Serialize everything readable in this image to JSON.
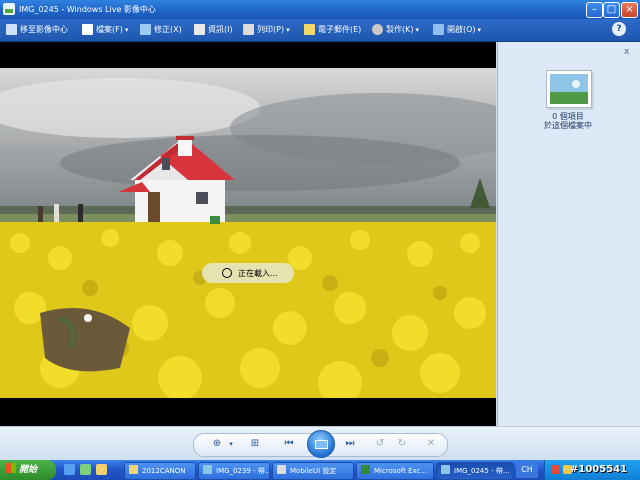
{
  "window": {
    "title": "IMG_0245 - Windows Live 影像中心"
  },
  "toolbar": {
    "items": [
      {
        "label": "移至影像中心",
        "has_menu": false
      },
      {
        "label": "檔案(F)",
        "has_menu": true
      },
      {
        "label": "修正(X)",
        "has_menu": false
      },
      {
        "label": "資訊(I)",
        "has_menu": false
      },
      {
        "label": "列印(P)",
        "has_menu": true
      },
      {
        "label": "電子郵件(E)",
        "has_menu": false
      },
      {
        "label": "製作(K)",
        "has_menu": true
      },
      {
        "label": "開啟(O)",
        "has_menu": true
      }
    ],
    "help_label": "?"
  },
  "viewer": {
    "loading_text": "正在載入..."
  },
  "info_pane": {
    "close_label": "x",
    "line1": "0 個項目",
    "line2": "於這個檔案中"
  },
  "controls": {
    "zoom_icon": "magnifier-icon",
    "fit_icon": "actual-size-icon",
    "prev_icon": "previous-icon",
    "slideshow_icon": "slideshow-icon",
    "next_icon": "next-icon",
    "rotate_ccw_icon": "rotate-counterclockwise-icon",
    "rotate_cw_icon": "rotate-clockwise-icon",
    "delete_icon": "delete-icon"
  },
  "taskbar": {
    "start_label": "開始",
    "tasks": [
      {
        "label": "2012CANON",
        "active": false
      },
      {
        "label": "IMG_0239 - 帶...",
        "active": false
      },
      {
        "label": "MobileUI 設定",
        "active": false
      },
      {
        "label": "Microsoft Exc...",
        "active": false
      },
      {
        "label": "IMG_0245 - 帶...",
        "active": true
      }
    ],
    "language": "CH",
    "watermark": "#1005541"
  },
  "colors": {
    "toolbar": "#2d6bc9",
    "pane": "#dde9f6",
    "accent": "#1f6fd1"
  }
}
